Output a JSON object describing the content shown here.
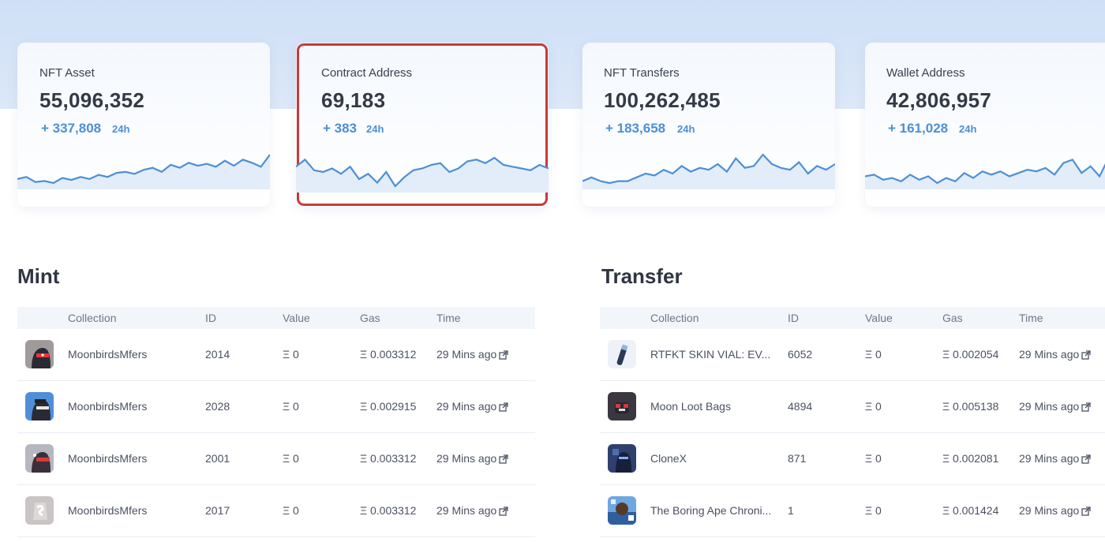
{
  "stats": [
    {
      "label": "NFT Asset",
      "value": "55,096,352",
      "delta": "+ 337,808",
      "period": "24h",
      "trend": [
        22,
        24,
        19,
        20,
        18,
        23,
        21,
        24,
        22,
        26,
        24,
        28,
        29,
        27,
        31,
        33,
        29,
        36,
        33,
        38,
        35,
        37,
        34,
        40,
        35,
        41,
        38,
        34,
        46
      ]
    },
    {
      "label": "Contract Address",
      "value": "69,183",
      "delta": "+ 383",
      "period": "24h",
      "trend": [
        40,
        44,
        38,
        37,
        39,
        36,
        40,
        33,
        36,
        31,
        37,
        29,
        34,
        38,
        39,
        41,
        42,
        37,
        39,
        43,
        44,
        42,
        45,
        41,
        40,
        39,
        38,
        41,
        39
      ]
    },
    {
      "label": "NFT Transfers",
      "value": "100,262,485",
      "delta": "+ 183,658",
      "period": "24h",
      "trend": [
        30,
        32,
        30,
        29,
        30,
        30,
        32,
        34,
        33,
        36,
        34,
        38,
        35,
        37,
        36,
        39,
        35,
        42,
        37,
        38,
        44,
        39,
        37,
        36,
        40,
        34,
        38,
        36,
        39
      ]
    },
    {
      "label": "Wallet Address",
      "value": "42,806,957",
      "delta": "+ 161,028",
      "period": "24h",
      "trend": [
        33,
        34,
        31,
        32,
        30,
        34,
        31,
        33,
        29,
        32,
        30,
        35,
        32,
        36,
        34,
        36,
        33,
        35,
        37,
        36,
        38,
        34,
        41,
        43,
        35,
        39,
        33,
        44,
        46
      ]
    }
  ],
  "mint": {
    "title": "Mint",
    "columns": [
      "Collection",
      "ID",
      "Value",
      "Gas",
      "Time"
    ],
    "rows": [
      {
        "collection": "MoonbirdsMfers",
        "id": "2014",
        "value": "Ξ 0",
        "gas": "Ξ 0.003312",
        "time": "29 Mins ago",
        "thumb": "bird-dark"
      },
      {
        "collection": "MoonbirdsMfers",
        "id": "2028",
        "value": "Ξ 0",
        "gas": "Ξ 0.002915",
        "time": "29 Mins ago",
        "thumb": "bird-blue"
      },
      {
        "collection": "MoonbirdsMfers",
        "id": "2001",
        "value": "Ξ 0",
        "gas": "Ξ 0.003312",
        "time": "29 Mins ago",
        "thumb": "bird-red"
      },
      {
        "collection": "MoonbirdsMfers",
        "id": "2017",
        "value": "Ξ 0",
        "gas": "Ξ 0.003312",
        "time": "29 Mins ago",
        "thumb": "bird-grey"
      }
    ]
  },
  "transfer": {
    "title": "Transfer",
    "columns": [
      "Collection",
      "ID",
      "Value",
      "Gas",
      "Time"
    ],
    "rows": [
      {
        "collection": "RTFKT SKIN VIAL: EV...",
        "id": "6052",
        "value": "Ξ 0",
        "gas": "Ξ 0.002054",
        "time": "29 Mins ago",
        "thumb": "vial"
      },
      {
        "collection": "Moon Loot Bags",
        "id": "4894",
        "value": "Ξ 0",
        "gas": "Ξ 0.005138",
        "time": "29 Mins ago",
        "thumb": "loot-bag"
      },
      {
        "collection": "CloneX",
        "id": "871",
        "value": "Ξ 0",
        "gas": "Ξ 0.002081",
        "time": "29 Mins ago",
        "thumb": "clonex"
      },
      {
        "collection": "The Boring Ape Chroni...",
        "id": "1",
        "value": "Ξ 0",
        "gas": "Ξ 0.001424",
        "time": "29 Mins ago",
        "thumb": "ape-chronicles"
      }
    ]
  },
  "colors": {
    "accent": "#4c8fd6",
    "highlight": "#c8393b"
  }
}
